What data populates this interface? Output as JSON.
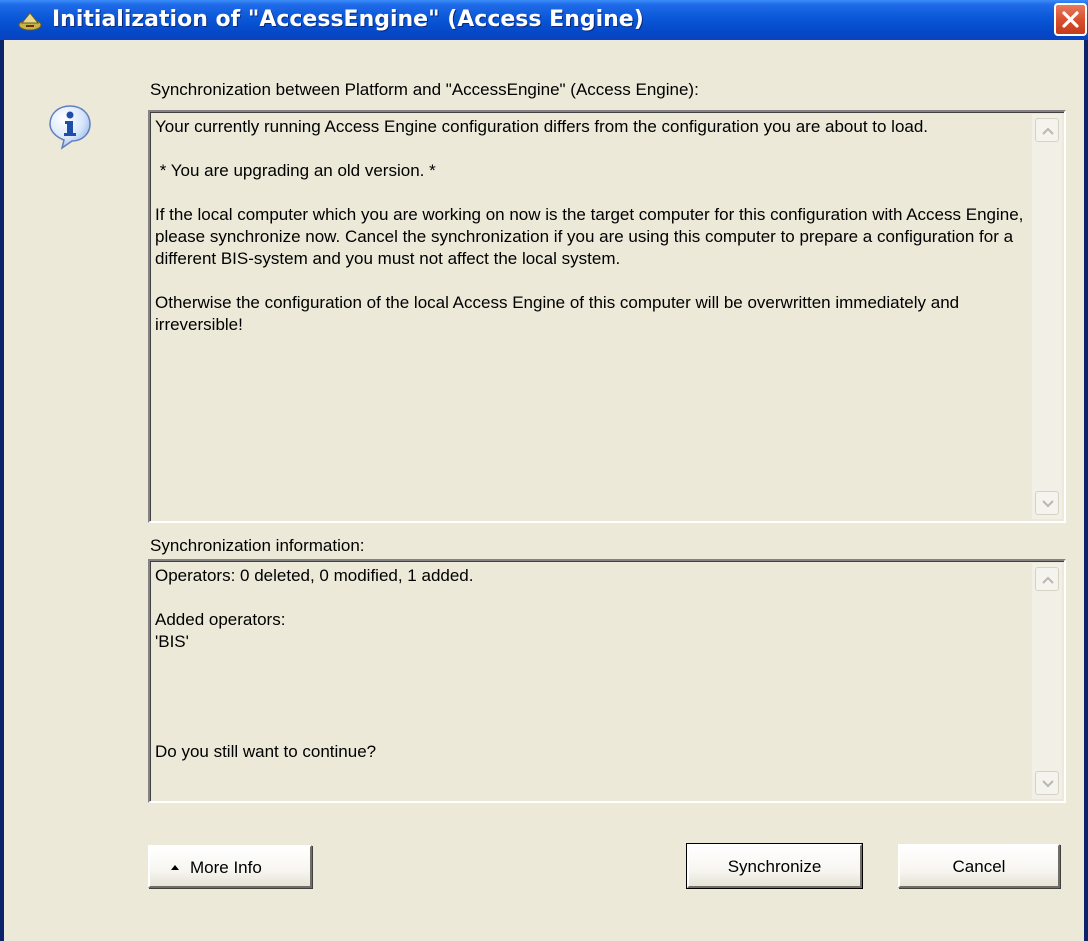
{
  "window": {
    "title": "Initialization of \"AccessEngine\" (Access Engine)",
    "icon": "app-icon",
    "close_icon": "close-icon"
  },
  "dialog": {
    "icon": "info-icon",
    "section1_label": "Synchronization between Platform and \"AccessEngine\" (Access Engine):",
    "message_paragraphs": [
      "Your currently running Access Engine configuration differs from the configuration you are about to load.",
      " * You are upgrading an old version. *",
      "If the local computer which you are working on now is the target computer for this configuration with Access Engine, please synchronize now. Cancel the synchronization if you are using this computer to prepare a configuration for a different BIS-system and you must not affect the local system.",
      "Otherwise the configuration of the local Access Engine of this computer will be overwritten immediately and irreversible!"
    ],
    "section2_label": "Synchronization information:",
    "info_lines": {
      "operators_summary": "Operators: 0 deleted, 0 modified, 1 added.",
      "added_header": "Added operators:",
      "added_item": "'BIS'",
      "question": "Do you still want to continue?"
    }
  },
  "buttons": {
    "more_info": "More Info",
    "synchronize": "Synchronize",
    "cancel": "Cancel"
  },
  "colors": {
    "titlebar": "#0a58d8",
    "dialog_bg": "#ece9d8",
    "close_button": "#d8502e"
  }
}
